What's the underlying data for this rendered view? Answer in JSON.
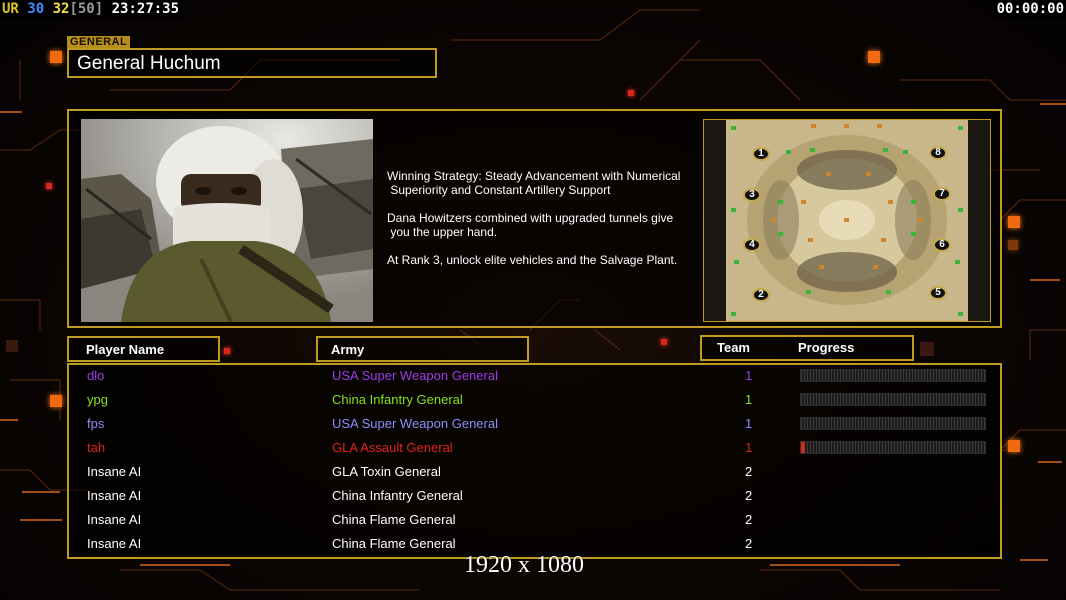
{
  "hud": {
    "ur_label": "UR",
    "val_blue": "30",
    "val_yellow": "32",
    "bracket_val": "[50]",
    "clock": "23:27:35",
    "timer": "00:00:00",
    "colors": {
      "ur": "#d9c326",
      "blue": "#3f8bff",
      "yellow": "#f4e23c",
      "bracket": "#9a9a9a"
    }
  },
  "general": {
    "tag": "GENERAL",
    "name": "General Huchum"
  },
  "strategy": [
    "Winning Strategy: Steady Advancement with Numerical\n Superiority and Constant Artillery Support",
    "Dana Howitzers combined with upgraded tunnels give\n you the upper hand.",
    "At Rank 3, unlock elite vehicles and the Salvage Plant."
  ],
  "map": {
    "start_positions": [
      "1",
      "2",
      "3",
      "4",
      "5",
      "6",
      "7",
      "8"
    ]
  },
  "columns": {
    "player_name": "Player Name",
    "army": "Army",
    "team": "Team",
    "progress": "Progress"
  },
  "players": [
    {
      "name": "dlo",
      "army": "USA Super Weapon General",
      "team": "1",
      "color": "#9a3ee8",
      "progress": 0.0,
      "show_bar": true
    },
    {
      "name": "ypg",
      "army": "China Infantry General",
      "team": "1",
      "color": "#86e21c",
      "progress": 0.0,
      "show_bar": true
    },
    {
      "name": "fps",
      "army": "USA Super Weapon General",
      "team": "1",
      "color": "#8c8ef6",
      "progress": 0.0,
      "show_bar": true
    },
    {
      "name": "tah",
      "army": "GLA Assault General",
      "team": "1",
      "color": "#e02418",
      "progress": 0.02,
      "show_bar": true
    },
    {
      "name": "Insane AI",
      "army": "GLA Toxin General",
      "team": "2",
      "color": "#ffffff",
      "progress": null,
      "show_bar": false
    },
    {
      "name": "Insane AI",
      "army": "China Infantry General",
      "team": "2",
      "color": "#ffffff",
      "progress": null,
      "show_bar": false
    },
    {
      "name": "Insane AI",
      "army": "China Flame General",
      "team": "2",
      "color": "#ffffff",
      "progress": null,
      "show_bar": false
    },
    {
      "name": "Insane AI",
      "army": "China Flame General",
      "team": "2",
      "color": "#ffffff",
      "progress": null,
      "show_bar": false
    }
  ],
  "resolution_caption": "1920 x 1080",
  "accent": {
    "gold": "#c19a22",
    "orange": "#f26a10"
  }
}
